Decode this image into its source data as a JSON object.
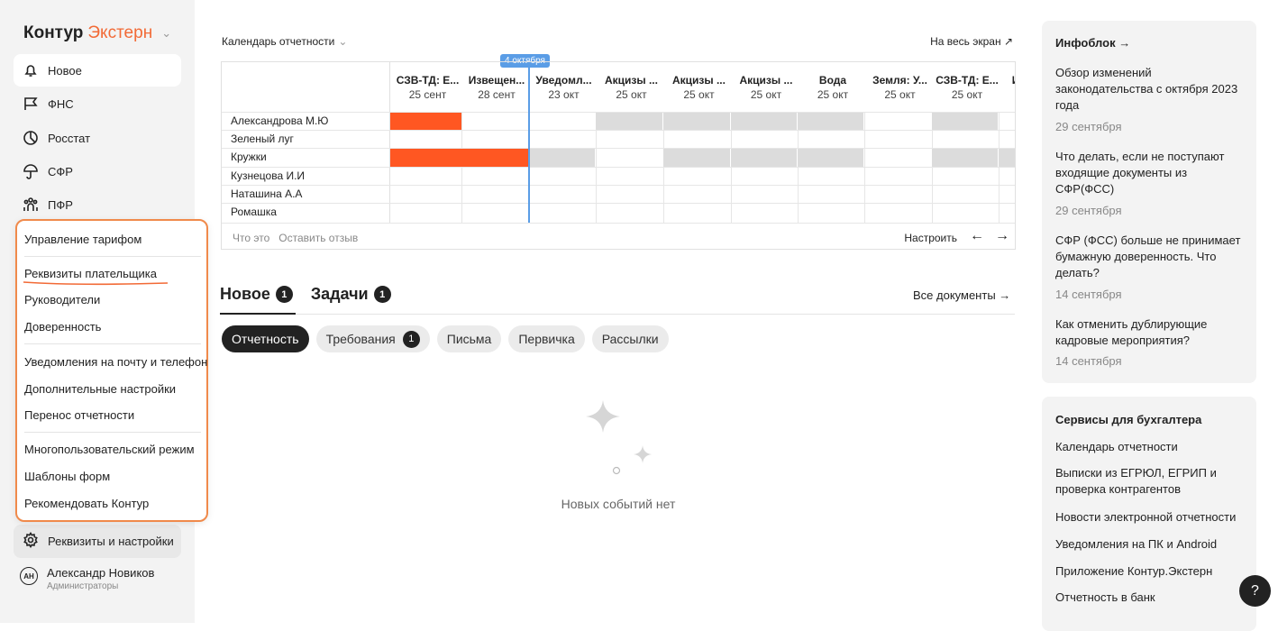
{
  "brand": {
    "part1": "Контур",
    "part2": "Экстерн"
  },
  "nav": [
    {
      "label": "Новое",
      "icon": "bell-icon",
      "active": true
    },
    {
      "label": "ФНС",
      "icon": "flag-icon"
    },
    {
      "label": "Росстат",
      "icon": "pie-chart-icon"
    },
    {
      "label": "СФР",
      "icon": "umbrella-icon"
    },
    {
      "label": "ПФР",
      "icon": "people-icon"
    }
  ],
  "menu": [
    "Управление тарифом",
    "Реквизиты плательщика",
    "Руководители",
    "Доверенность",
    "Уведомления на почту и телефон",
    "Дополнительные настройки",
    "Перенос отчетности",
    "Многопользовательский режим",
    "Шаблоны форм",
    "Рекомендовать Контур"
  ],
  "settings_label": "Реквизиты и настройки",
  "user": {
    "initials": "АН",
    "name": "Александр Новиков",
    "role": "Администраторы"
  },
  "calendar": {
    "title": "Календарь отчетности",
    "fullscreen": "На весь экран",
    "today_label": "4 октября",
    "columns": [
      {
        "name": "СЗВ-ТД: Е...",
        "date": "25 сент"
      },
      {
        "name": "Извещен...",
        "date": "28 сент"
      },
      {
        "name": "Уведомл...",
        "date": "23 окт"
      },
      {
        "name": "Акцизы ...",
        "date": "25 окт"
      },
      {
        "name": "Акцизы ...",
        "date": "25 окт"
      },
      {
        "name": "Акцизы ...",
        "date": "25 окт"
      },
      {
        "name": "Вода",
        "date": "25 окт"
      },
      {
        "name": "Земля: У...",
        "date": "25 окт"
      },
      {
        "name": "СЗВ-ТД: Е...",
        "date": "25 окт"
      },
      {
        "name": "Из",
        "date": ""
      }
    ],
    "rows": [
      "Александрова М.Ю",
      "Зеленый луг",
      "Кружки",
      "Кузнецова И.И",
      "Наташина А.А",
      "Ромашка"
    ],
    "footer_what": "Что это",
    "footer_feedback": "Оставить отзыв",
    "footer_configure": "Настроить",
    "colors": {
      "overdue": "#ff5722",
      "na": "#dcdcdc",
      "today": "#5a9de6"
    }
  },
  "tabs": [
    {
      "label": "Новое",
      "count": "1"
    },
    {
      "label": "Задачи",
      "count": "1"
    }
  ],
  "all_docs": "Все документы",
  "pills": [
    {
      "label": "Отчетность",
      "active": true
    },
    {
      "label": "Требования",
      "count": "1"
    },
    {
      "label": "Письма"
    },
    {
      "label": "Первичка"
    },
    {
      "label": "Рассылки"
    }
  ],
  "empty_text": "Новых событий нет",
  "infoblock": {
    "title": "Инфоблок",
    "items": [
      {
        "text": "Обзор изменений законодательства с октября 2023 года",
        "date": "29 сентября"
      },
      {
        "text": "Что делать, если не поступают входящие документы из СФР(ФСС)",
        "date": "29 сентября"
      },
      {
        "text": "СФР (ФСС) больше не принимает бумажную доверенность. Что делать?",
        "date": "14 сентября"
      },
      {
        "text": "Как отменить дублирующие кадровые мероприятия?",
        "date": "14 сентября"
      }
    ]
  },
  "services": {
    "title": "Сервисы для бухгалтера",
    "items": [
      "Календарь отчетности",
      "Выписки из ЕГРЮЛ, ЕГРИП и проверка контрагентов",
      "Новости электронной отчетности",
      "Уведомления на ПК и Android",
      "Приложение Контур.Экстерн",
      "Отчетность в банк"
    ]
  },
  "help": "?"
}
